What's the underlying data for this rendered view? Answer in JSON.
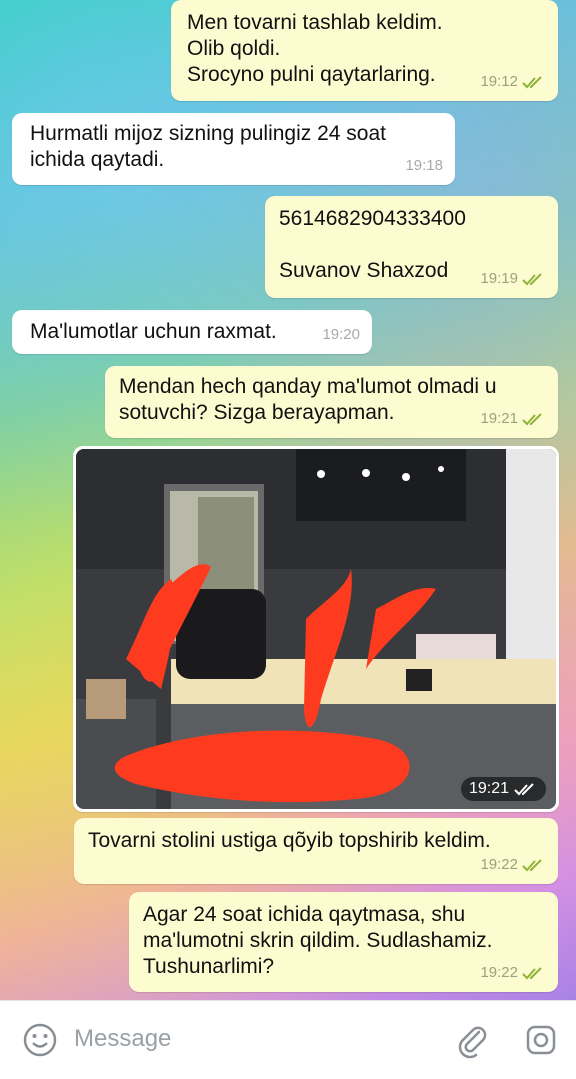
{
  "messages": [
    {
      "dir": "out",
      "text": "Men tovarni tashlab keldim.\nOlib qoldi.\nSrocyno pulni qaytarlaring.",
      "time": "19:12",
      "status": "read"
    },
    {
      "dir": "in",
      "text": "Hurmatli mijoz sizning pulingiz 24 soat\nichida qaytadi.",
      "time": "19:18"
    },
    {
      "dir": "out",
      "text": "5614682904333400\n\nSuvanov Shaxzod",
      "time": "19:19",
      "status": "read"
    },
    {
      "dir": "in",
      "text": "Ma'lumotlar uchun raxmat.",
      "time": "19:20"
    },
    {
      "dir": "out",
      "text": "Mendan hech qanday ma'lumot olmadi u\nsotuvchi? Sizga berayapman.",
      "time": "19:21",
      "status": "read"
    },
    {
      "dir": "out",
      "type": "photo",
      "time": "19:21",
      "status": "read"
    },
    {
      "dir": "out",
      "text": "Tovarni stolini ustiga qõyib topshirib keldim.",
      "time": "19:22",
      "status": "read"
    },
    {
      "dir": "out",
      "text": "Agar 24 soat ichida qaytmasa, shu\nma'lumotni skrin qildim. Sudlashamiz.\nTushunarlimi?",
      "time": "19:22",
      "status": "read"
    }
  ],
  "input": {
    "placeholder": "Message",
    "icons": [
      "emoji-icon",
      "attach-icon",
      "camera-icon"
    ]
  },
  "colors": {
    "outgoing_bubble": "#fdfbd0",
    "incoming_bubble": "#ffffff",
    "check_color": "#8fb33a"
  }
}
